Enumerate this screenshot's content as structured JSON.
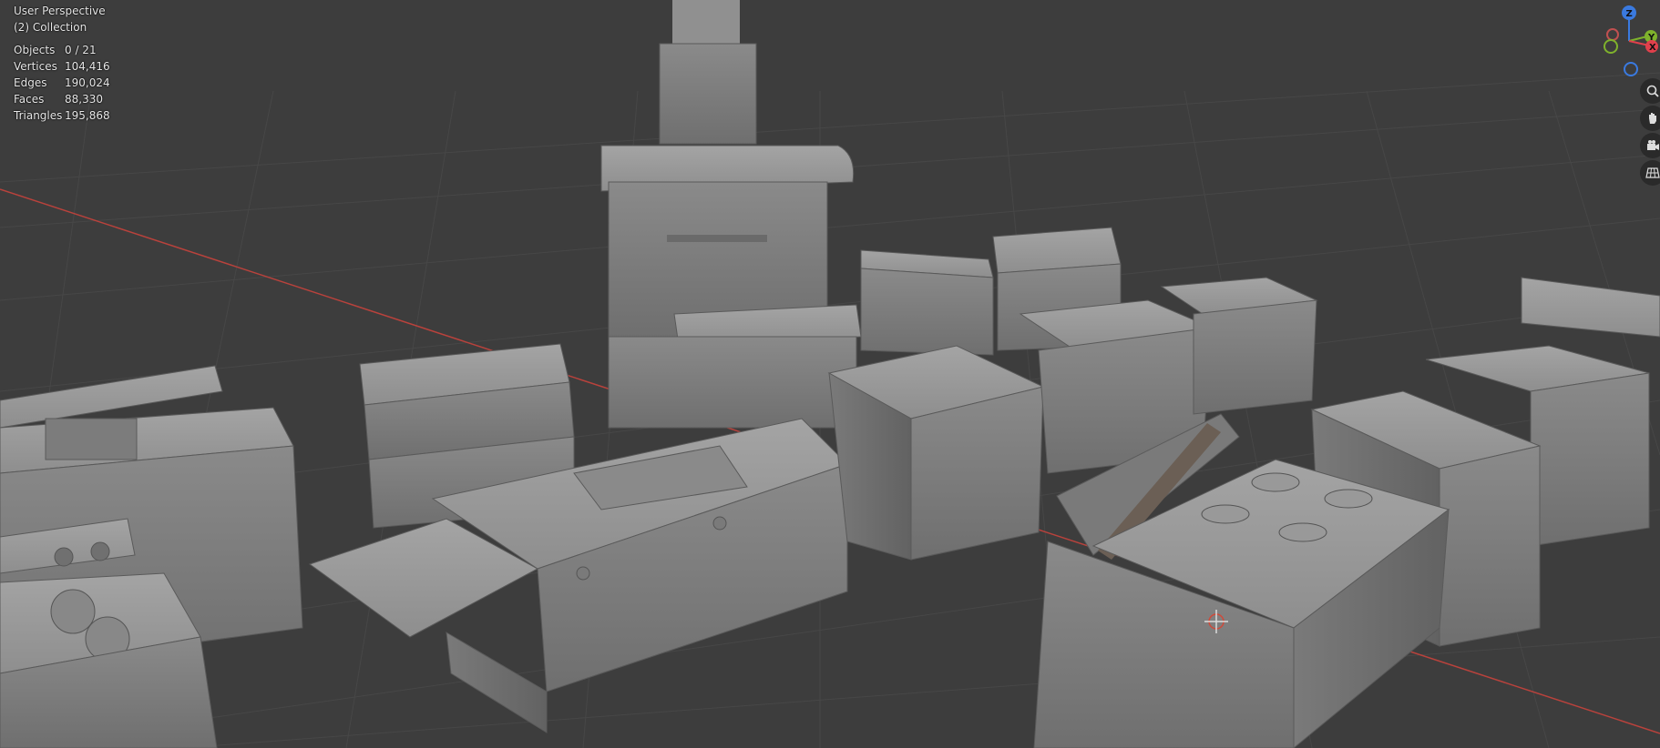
{
  "viewport": {
    "view_name": "User Perspective",
    "collection": "(2) Collection",
    "stats": [
      {
        "label": "Objects",
        "value": "0 / 21"
      },
      {
        "label": "Vertices",
        "value": "104,416"
      },
      {
        "label": "Edges",
        "value": "190,024"
      },
      {
        "label": "Faces",
        "value": "88,330"
      },
      {
        "label": "Triangles",
        "value": "195,868"
      }
    ]
  },
  "gizmo": {
    "z_label": "Z",
    "y_label": "Y",
    "x_label": "X",
    "colors": {
      "x": "#e0404c",
      "y": "#7fb22c",
      "z": "#3a7ae0"
    }
  },
  "nav_buttons": [
    {
      "icon": "zoom-icon"
    },
    {
      "icon": "hand-pan-icon"
    },
    {
      "icon": "camera-icon"
    },
    {
      "icon": "grid-perspective-icon"
    }
  ],
  "colors": {
    "background": "#3d3d3d",
    "grid": "#4a4a4a",
    "x_axis": "#b9423c",
    "object": "#8c8c8c"
  }
}
